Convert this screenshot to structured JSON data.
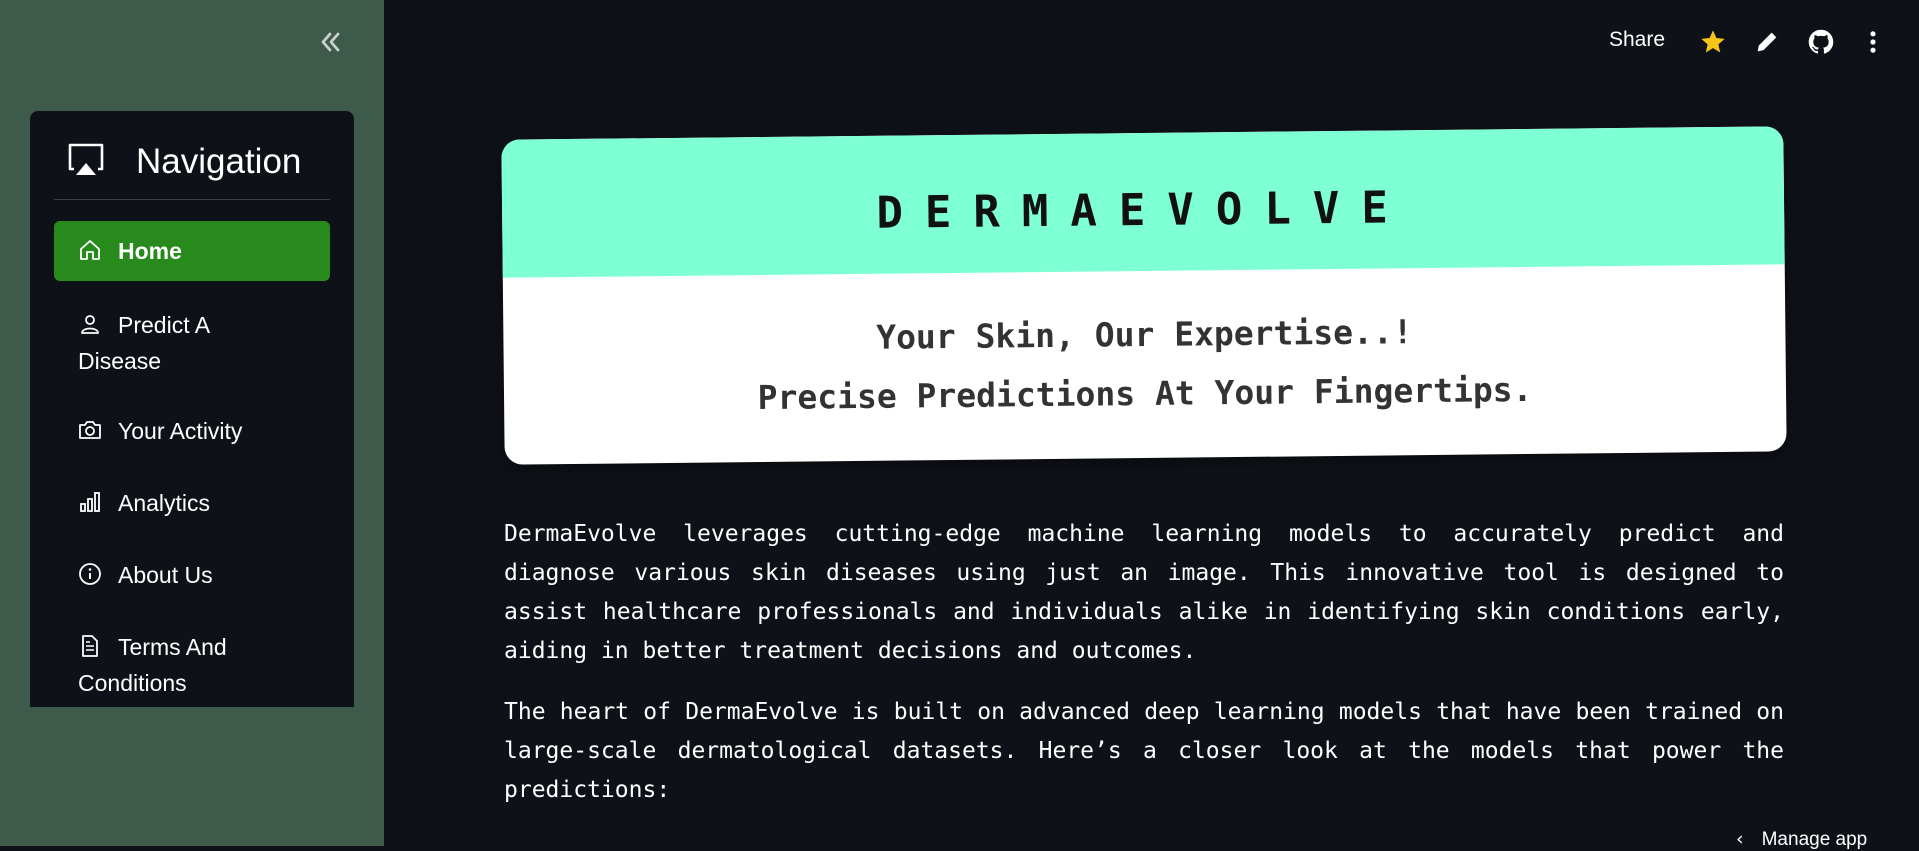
{
  "sidebar": {
    "collapse_icon": "double-chevron-left-icon",
    "nav_title": "Navigation",
    "nav_icon": "airplay-icon",
    "items": [
      {
        "label": "Home",
        "icon": "home-icon",
        "active": true
      },
      {
        "label": "Predict A Disease",
        "icon": "user-icon",
        "active": false
      },
      {
        "label": "Your Activity",
        "icon": "camera-icon",
        "active": false
      },
      {
        "label": "Analytics",
        "icon": "bar-chart-icon",
        "active": false
      },
      {
        "label": "About Us",
        "icon": "info-icon",
        "active": false
      },
      {
        "label": "Terms And Conditions",
        "icon": "document-icon",
        "active": false
      }
    ],
    "active_color": "#288a1d",
    "background_color": "#3e5a4b"
  },
  "toolbar": {
    "share_label": "Share",
    "icons": [
      "star-icon",
      "pencil-icon",
      "github-icon",
      "more-vertical-icon"
    ],
    "star_color": "#f5c518"
  },
  "hero": {
    "title": "DERMAEVOLVE",
    "tagline_1": "Your Skin, Our Expertise..!",
    "tagline_2": "Precise Predictions At Your Fingertips.",
    "accent_color": "#7fffd4"
  },
  "content": {
    "paragraph_1": "DermaEvolve leverages cutting-edge machine learning models to accurately predict and diagnose various skin diseases using just an image. This innovative tool is designed to assist healthcare professionals and individuals alike in identifying skin conditions early, aiding in better treatment decisions and outcomes.",
    "paragraph_2": "The heart of DermaEvolve is built on advanced deep learning models that have been trained on large-scale dermatological datasets. Here’s a closer look at the models that power the predictions:"
  },
  "footer": {
    "manage_app_label": "Manage app"
  }
}
